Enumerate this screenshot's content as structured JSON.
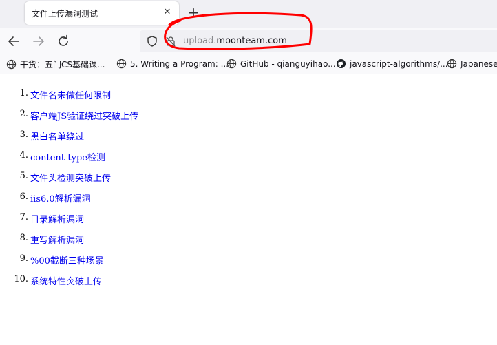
{
  "tab": {
    "title": "文件上传漏洞测试",
    "close_glyph": "✕"
  },
  "new_tab_glyph": "+",
  "urlbar": {
    "url_dim": "upload.",
    "url_host": "moonteam.com"
  },
  "bookmarks": [
    {
      "label": "干货：五门CS基础课...",
      "icon": "globe-icon"
    },
    {
      "label": "5. Writing a Program: ...",
      "icon": "globe-icon"
    },
    {
      "label": "GitHub - qianguyihao...",
      "icon": "globe-icon"
    },
    {
      "label": "javascript-algorithms/...",
      "icon": "github-icon"
    },
    {
      "label": "Japanese L",
      "icon": "globe-icon"
    }
  ],
  "list": [
    {
      "num": "1.",
      "label": "文件名未做任何限制"
    },
    {
      "num": "2.",
      "label": "客户端JS验证绕过突破上传"
    },
    {
      "num": "3.",
      "label": "黑白名单绕过"
    },
    {
      "num": "4.",
      "label": "content-type检测"
    },
    {
      "num": "5.",
      "label": "文件头检测突破上传"
    },
    {
      "num": "6.",
      "label": "iis6.0解析漏洞"
    },
    {
      "num": "7.",
      "label": "目录解析漏洞"
    },
    {
      "num": "8.",
      "label": "重写解析漏洞"
    },
    {
      "num": "9.",
      "label": "%00截断三种场景"
    },
    {
      "num": "10.",
      "label": "系统特性突破上传"
    }
  ],
  "colors": {
    "link": "#0000ee",
    "annotation": "#ff0000",
    "tabstrip": "#f0f0f4",
    "toolbar": "#f9f9fb"
  }
}
